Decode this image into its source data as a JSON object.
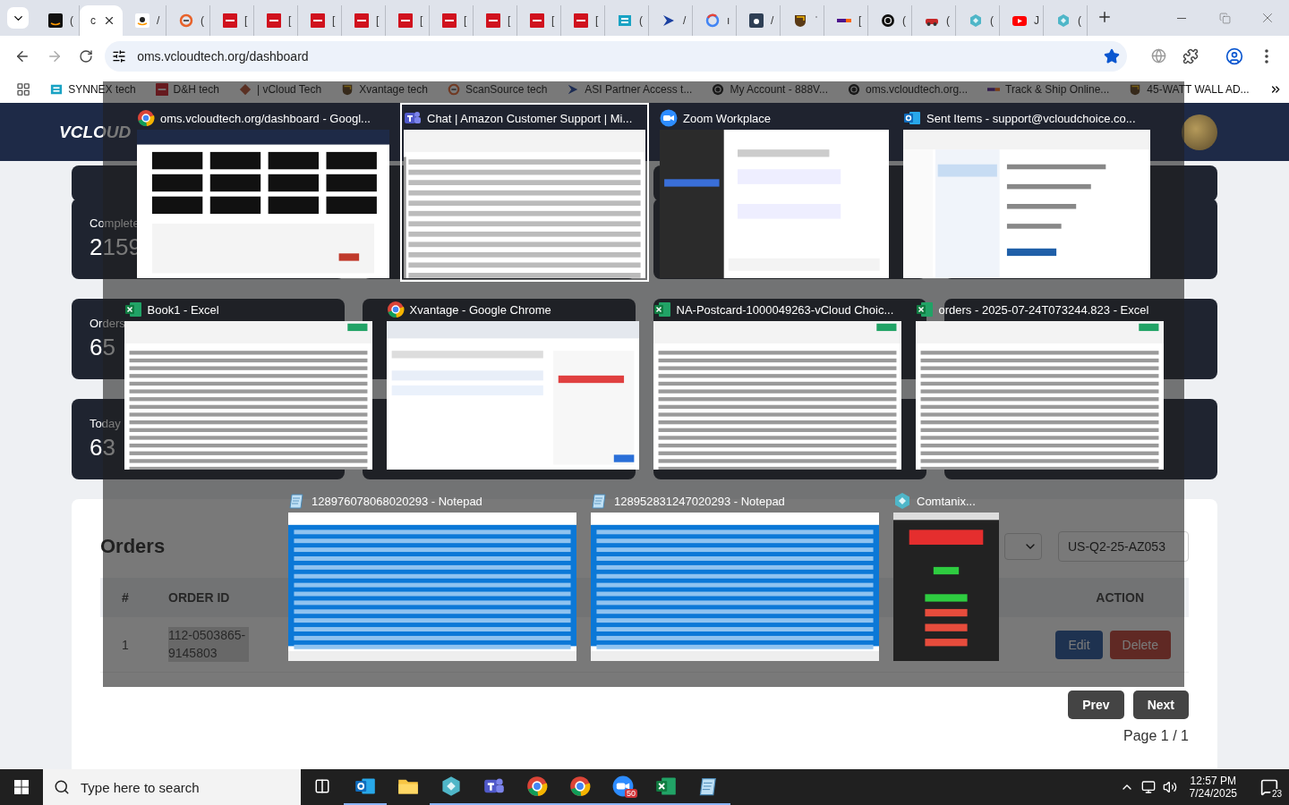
{
  "browser": {
    "tabs": [
      {
        "kind": "dark-tile",
        "label": "(",
        "selected": false
      },
      {
        "kind": "none",
        "label": "c",
        "selected": true
      },
      {
        "kind": "light-tile",
        "label": "/",
        "selected": false
      },
      {
        "kind": "ring",
        "label": "(",
        "selected": false
      },
      {
        "kind": "red-tile",
        "label": "[",
        "selected": false
      },
      {
        "kind": "red-tile",
        "label": "[",
        "selected": false
      },
      {
        "kind": "red-tile",
        "label": "[",
        "selected": false
      },
      {
        "kind": "red-tile",
        "label": "[",
        "selected": false
      },
      {
        "kind": "red-tile",
        "label": "[",
        "selected": false
      },
      {
        "kind": "red-tile",
        "label": "[",
        "selected": false
      },
      {
        "kind": "red-tile",
        "label": "[",
        "selected": false
      },
      {
        "kind": "red-tile",
        "label": "[",
        "selected": false
      },
      {
        "kind": "red-tile",
        "label": "[",
        "selected": false
      },
      {
        "kind": "teal-tile",
        "label": "(",
        "selected": false
      },
      {
        "kind": "arrow",
        "label": "/",
        "selected": false
      },
      {
        "kind": "g-ring",
        "label": "ı",
        "selected": false
      },
      {
        "kind": "slate-tile",
        "label": "/",
        "selected": false
      },
      {
        "kind": "shield",
        "label": "ˈ",
        "selected": false
      },
      {
        "kind": "stripe",
        "label": "[",
        "selected": false
      },
      {
        "kind": "knot",
        "label": "(",
        "selected": false
      },
      {
        "kind": "car",
        "label": "(",
        "selected": false
      },
      {
        "kind": "hexagon",
        "label": "(",
        "selected": false
      },
      {
        "kind": "play",
        "label": "J",
        "selected": false
      },
      {
        "kind": "hexagon",
        "label": "(",
        "selected": false
      }
    ],
    "address": "oms.vcloudtech.org/dashboard",
    "bookmarked": true,
    "bookmarks": [
      {
        "kind": "teal-tile",
        "label": "SYNNEX tech"
      },
      {
        "kind": "red-tile",
        "label": "D&H tech"
      },
      {
        "kind": "diamond",
        "label": "| vCloud Tech"
      },
      {
        "kind": "shield",
        "label": "Xvantage tech"
      },
      {
        "kind": "ring",
        "label": "ScanSource tech"
      },
      {
        "kind": "arrow",
        "label": "ASI Partner Access t..."
      },
      {
        "kind": "knot",
        "label": "My Account - 888V..."
      },
      {
        "kind": "knot",
        "label": "oms.vcloudtech.org..."
      },
      {
        "kind": "stripe",
        "label": "Track & Ship Online..."
      },
      {
        "kind": "shield",
        "label": "45-WATT WALL AD..."
      }
    ]
  },
  "page": {
    "logo": "VCLOUD",
    "stat_rows": [
      {
        "label": "Complete",
        "value": "2159"
      },
      {
        "label": "Orders",
        "value": "65"
      },
      {
        "label": "Today",
        "value": "63"
      }
    ],
    "orders": {
      "title": "Orders",
      "search": "US-Q2-25-AZ053",
      "columns": [
        "#",
        "ORDER ID",
        "ACTION"
      ],
      "rows": [
        {
          "index": "1",
          "order_id": "112-0503865-9145803",
          "actions": [
            "Edit",
            "Delete"
          ]
        }
      ],
      "pager": [
        "Prev",
        "Next"
      ],
      "page_info": "Page 1 / 1"
    }
  },
  "switcher": {
    "windows": [
      {
        "kind": "dashboard",
        "title": "oms.vcloudtech.org/dashboard - Googl...",
        "selected": false
      },
      {
        "kind": "spreadsheet",
        "title": "Chat | Amazon Customer Support | Mi...",
        "selected": true
      },
      {
        "kind": "chat",
        "title": "Zoom Workplace",
        "selected": false
      },
      {
        "kind": "email",
        "title": "Sent Items - support@vcloudchoice.co...",
        "selected": false
      },
      {
        "kind": "sheet",
        "title": "Book1 - Excel",
        "selected": false
      },
      {
        "kind": "browser",
        "title": "Xvantage - Google Chrome",
        "selected": false
      },
      {
        "kind": "sheet",
        "title": "NA-Postcard-1000049263-vCloud Choic...",
        "selected": false
      },
      {
        "kind": "sheet",
        "title": "orders - 2025-07-24T073244.823 - Excel",
        "selected": false
      },
      {
        "kind": "notepad",
        "title": "128976078068020293 - Notepad",
        "selected": false
      },
      {
        "kind": "notepad",
        "title": "128952831247020293 - Notepad",
        "selected": false
      },
      {
        "kind": "mobile",
        "title": "Comtanix...",
        "selected": false
      }
    ]
  },
  "taskbar": {
    "search_placeholder": "Type here to search",
    "apps": [
      {
        "kind": "outlook"
      },
      {
        "kind": "folder"
      },
      {
        "kind": "hexagon"
      },
      {
        "kind": "teams"
      },
      {
        "kind": "chrome"
      },
      {
        "kind": "chrome"
      },
      {
        "kind": "zoom",
        "badge": "50"
      },
      {
        "kind": "excel"
      },
      {
        "kind": "notepad"
      }
    ],
    "time": "12:57 PM",
    "date": "7/24/2025",
    "notifications": "23"
  }
}
